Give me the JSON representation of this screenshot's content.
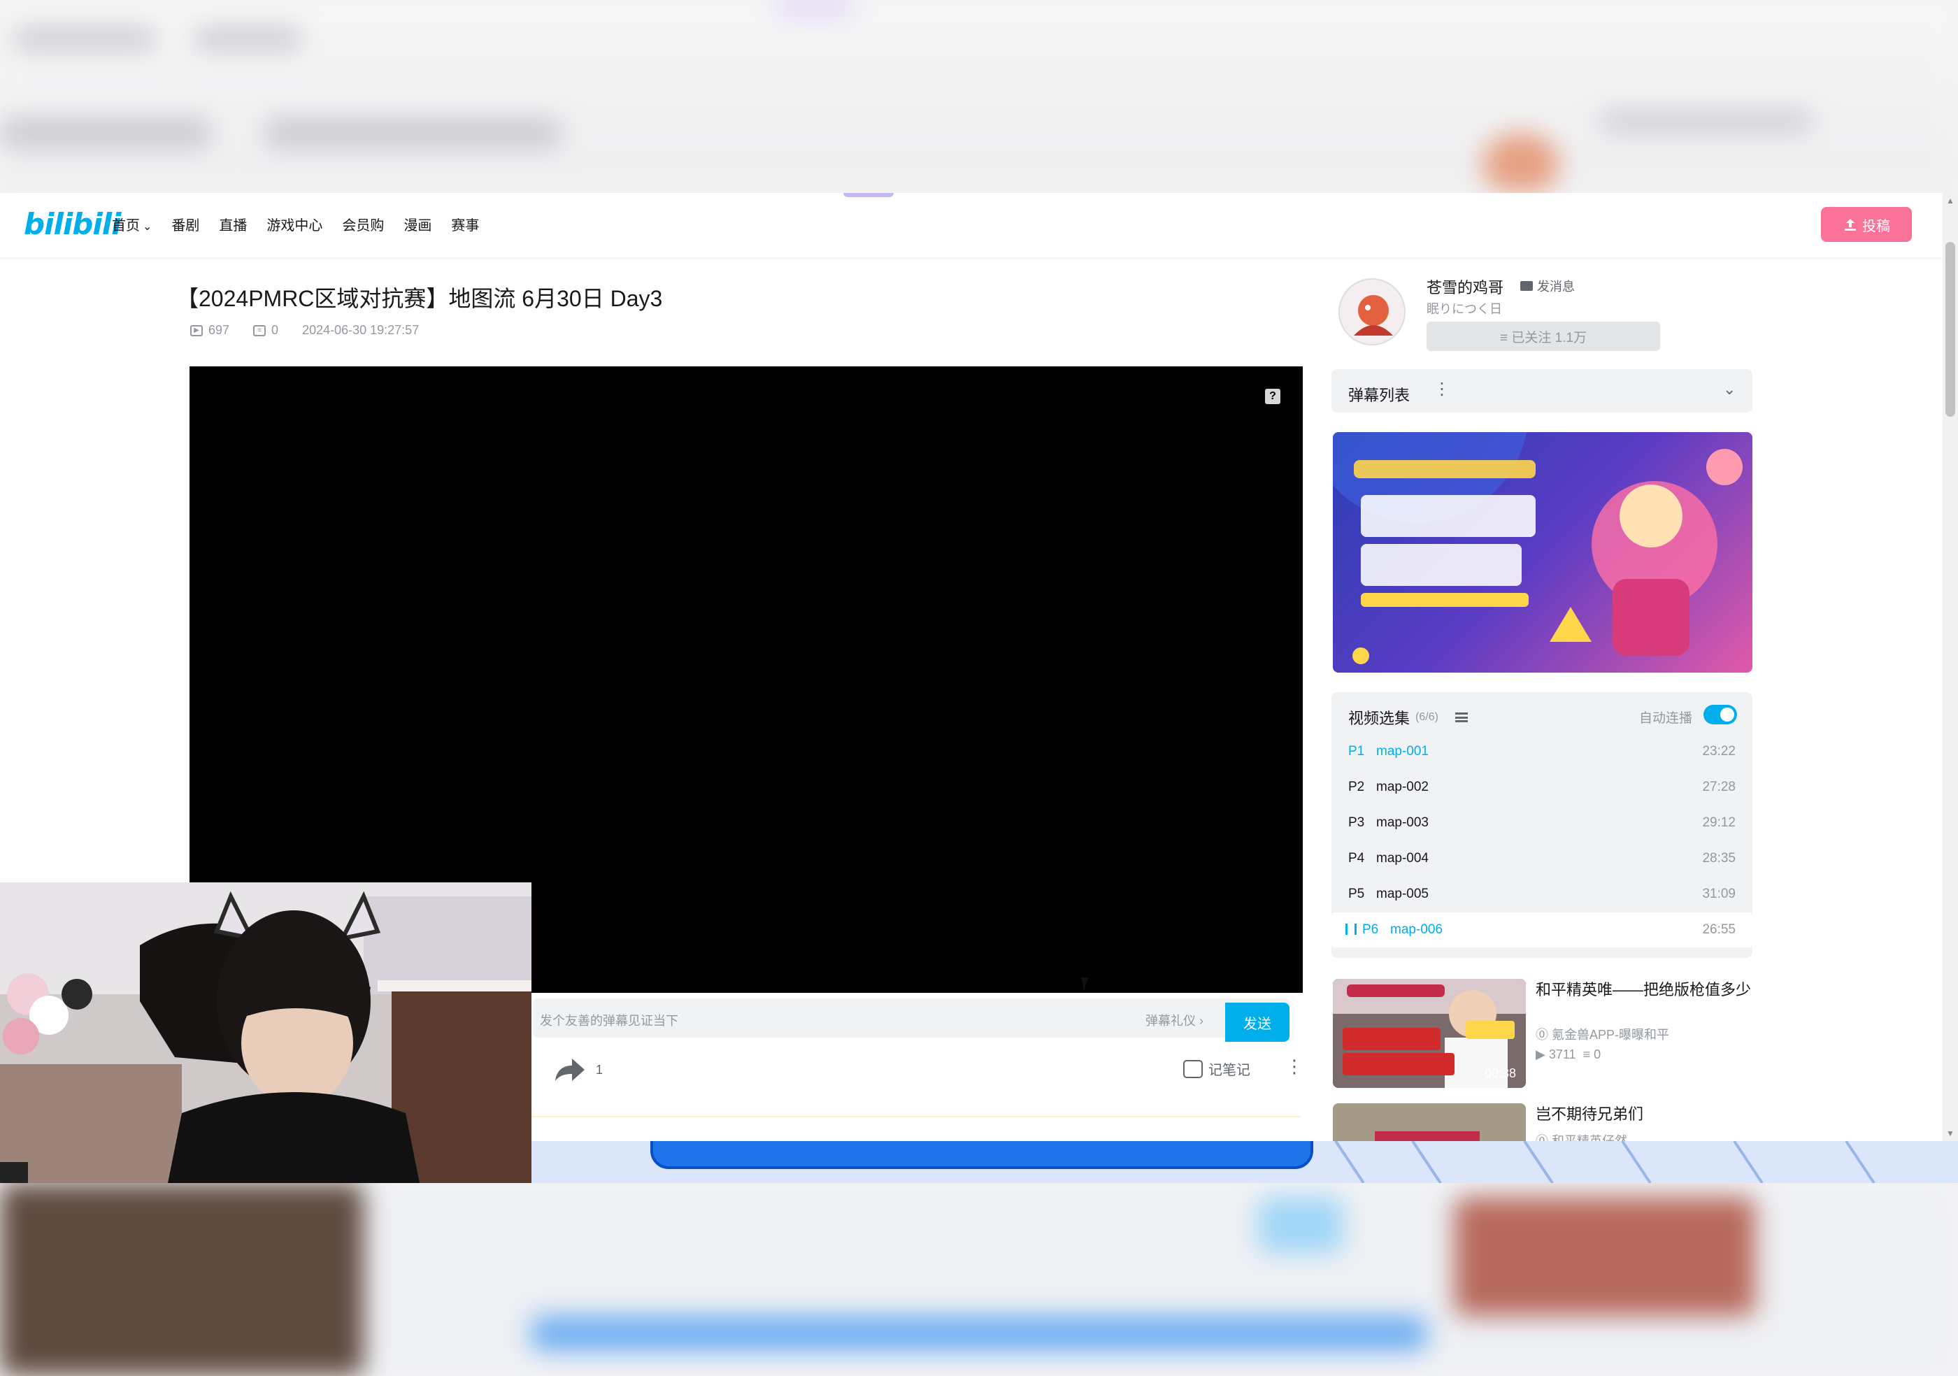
{
  "header": {
    "logo": "bilibili",
    "nav": [
      "首页",
      "番剧",
      "直播",
      "游戏中心",
      "会员购",
      "漫画",
      "赛事"
    ],
    "upload_label": "投稿"
  },
  "video": {
    "title": "【2024PMRC区域对抗赛】地图流 6月30日 Day3",
    "views": "697",
    "danmaku_count": "0",
    "pubdate": "2024-06-30 19:27:57"
  },
  "danmaku": {
    "placeholder": "发个友善的弹幕见证当下",
    "etiquette": "弹幕礼仪 ›",
    "send": "发送"
  },
  "actions": {
    "share_count": "1",
    "note": "记笔记"
  },
  "uploader": {
    "name": "苍雪的鸡哥",
    "message": "发消息",
    "desc": "眠りにつく日",
    "follow": "≡ 已关注 1.1万"
  },
  "danmaku_list": {
    "title": "弹幕列表"
  },
  "episodes": {
    "title": "视频选集",
    "count": "(6/6)",
    "autoplay": "自动连播",
    "items": [
      {
        "p": "P1",
        "name": "map-001",
        "duration": "23:22"
      },
      {
        "p": "P2",
        "name": "map-002",
        "duration": "27:28"
      },
      {
        "p": "P3",
        "name": "map-003",
        "duration": "29:12"
      },
      {
        "p": "P4",
        "name": "map-004",
        "duration": "28:35"
      },
      {
        "p": "P5",
        "name": "map-005",
        "duration": "31:09"
      },
      {
        "p": "P6",
        "name": "map-006",
        "duration": "26:55"
      }
    ]
  },
  "recommendations": [
    {
      "title": "和平精英唯——把绝版枪值多少",
      "author": "氪金兽APP-曝曝和平",
      "views": "3711",
      "comments": "0",
      "duration": "00:38"
    },
    {
      "title": "岂不期待兄弟们",
      "author": "和平精英仔然"
    }
  ],
  "colors": {
    "accent": "#00aeec",
    "pink": "#fb7299"
  },
  "icons": [
    "play-count-icon",
    "danmaku-count-icon",
    "share-icon",
    "note-icon",
    "more-icon",
    "mail-icon",
    "list-icon",
    "chevron-down-icon",
    "help-icon",
    "upload-icon"
  ]
}
